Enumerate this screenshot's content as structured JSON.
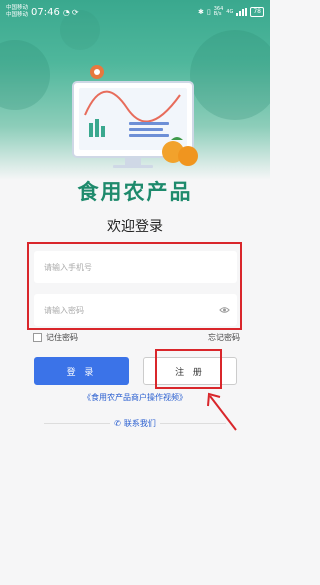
{
  "status_bar": {
    "carrier1": "中国移动",
    "carrier2": "中国移动",
    "time": "07:46",
    "net_speed": "364",
    "net_unit": "B/s",
    "network": "4G",
    "battery": "78"
  },
  "brand": {
    "title": "食用农产品"
  },
  "login": {
    "welcome": "欢迎登录",
    "phone_placeholder": "请输入手机号",
    "password_placeholder": "请输入密码",
    "remember_label": "记住密码",
    "forgot_label": "忘记密码",
    "login_button": "登 录",
    "register_button": "注 册",
    "video_link": "《食用农产品商户操作视频》",
    "contact_link": "联系我们"
  },
  "colors": {
    "brand_green": "#1e8a6c",
    "primary_blue": "#3b73e8",
    "annotation_red": "#d9262b"
  },
  "icons": [
    "eye-icon",
    "phone-icon",
    "chart-icon",
    "orange-fruit-icon",
    "arrow-annotation-icon"
  ]
}
